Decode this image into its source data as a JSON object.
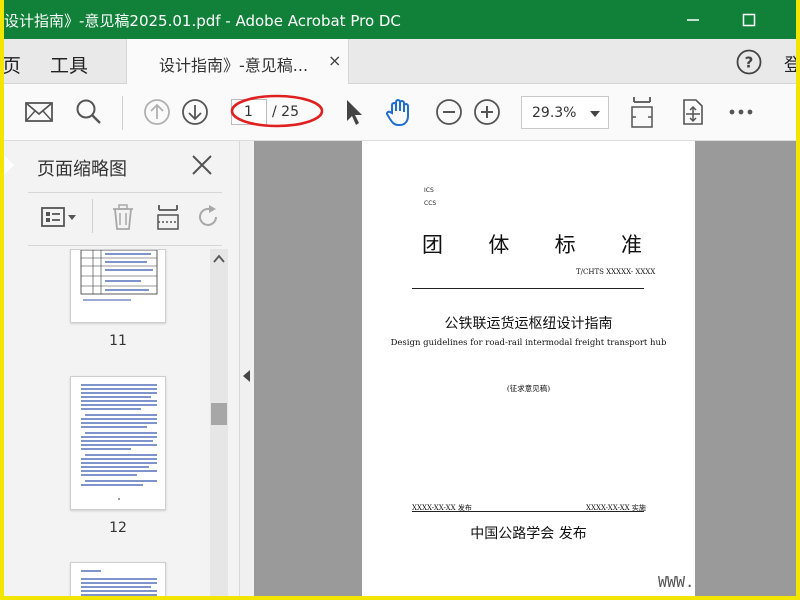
{
  "window": {
    "title": "设计指南》-意见稿2025.01.pdf - Adobe Acrobat Pro DC"
  },
  "menu": {
    "home": "页",
    "tools": "工具"
  },
  "tab": {
    "label": "设计指南》-意见稿...",
    "close": "×"
  },
  "header_right": {
    "sign_in": "登"
  },
  "toolbar": {
    "current_page": "1",
    "total_pages": "/ 25",
    "zoom": "29.3%"
  },
  "panel": {
    "title": "页面缩略图",
    "thumbnails": [
      {
        "label": "11"
      },
      {
        "label": "12"
      }
    ]
  },
  "document": {
    "ics": "ICS",
    "ccs": "CCS",
    "heading_chars": [
      "团",
      "体",
      "标",
      "准"
    ],
    "code": "T/CHTS XXXXX- XXXX",
    "cn_title": "公铁联运货运枢纽设计指南",
    "en_title": "Design guidelines for road-rail intermodal freight transport hub",
    "status": "(征求意见稿)",
    "issue_date": "XXXX-XX-XX 发布",
    "impl_date": "XXXX-XX-XX 实施",
    "publisher": "中国公路学会  发布"
  },
  "watermark": "WWW.",
  "colors": {
    "titlebar": "#11813a",
    "accent_blue": "#1f6fd1",
    "highlight_red": "#e02020",
    "outer_border": "#f2e600"
  }
}
